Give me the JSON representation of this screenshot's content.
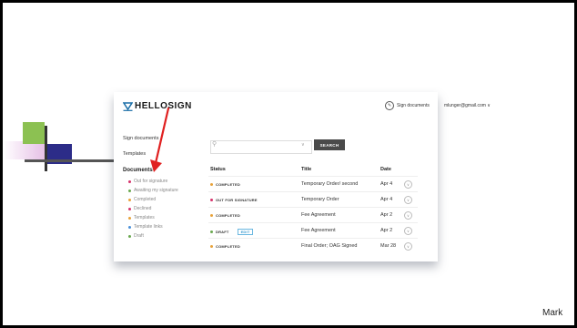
{
  "colors": {
    "brand": "#1b6fa8",
    "arrow": "#e02020",
    "completed": "#e8a23a",
    "out": "#d6336c",
    "draft": "#6aa84f"
  },
  "app": {
    "logo_text": "HELLOSIGN",
    "header": {
      "sign_label": "Sign documents",
      "email": "mlunger@gmail.com ∨"
    },
    "sidebar": {
      "sign_documents": "Sign documents",
      "templates": "Templates",
      "documents": "Documents",
      "subitems": [
        {
          "label": "Out for signature",
          "color": "#d6336c"
        },
        {
          "label": "Awaiting my signature",
          "color": "#6aa84f"
        },
        {
          "label": "Completed",
          "color": "#e8a23a"
        },
        {
          "label": "Declined",
          "color": "#d6336c"
        },
        {
          "label": "Templates",
          "color": "#e8a23a"
        },
        {
          "label": "Template links",
          "color": "#4a90d9"
        },
        {
          "label": "Draft",
          "color": "#6aa84f"
        }
      ]
    },
    "search": {
      "button": "SEARCH",
      "placeholder": ""
    },
    "table": {
      "headers": {
        "status": "Status",
        "title": "Title",
        "date": "Date"
      },
      "rows": [
        {
          "status": "COMPLETED",
          "title": "Temporary Order/ second",
          "date": "Apr 4"
        },
        {
          "status": "OUT FOR SIGNATURE",
          "title": "Temporary Order",
          "date": "Apr 4"
        },
        {
          "status": "COMPLETED",
          "title": "Fee Agreement",
          "date": "Apr 2"
        },
        {
          "status": "DRAFT",
          "badge": "EDIT",
          "title": "Fee Agreement",
          "date": "Apr 2"
        },
        {
          "status": "COMPLETED",
          "title": "Final Order; OAG Signed",
          "date": "Mar 28"
        }
      ]
    }
  },
  "presenter": "Mark"
}
